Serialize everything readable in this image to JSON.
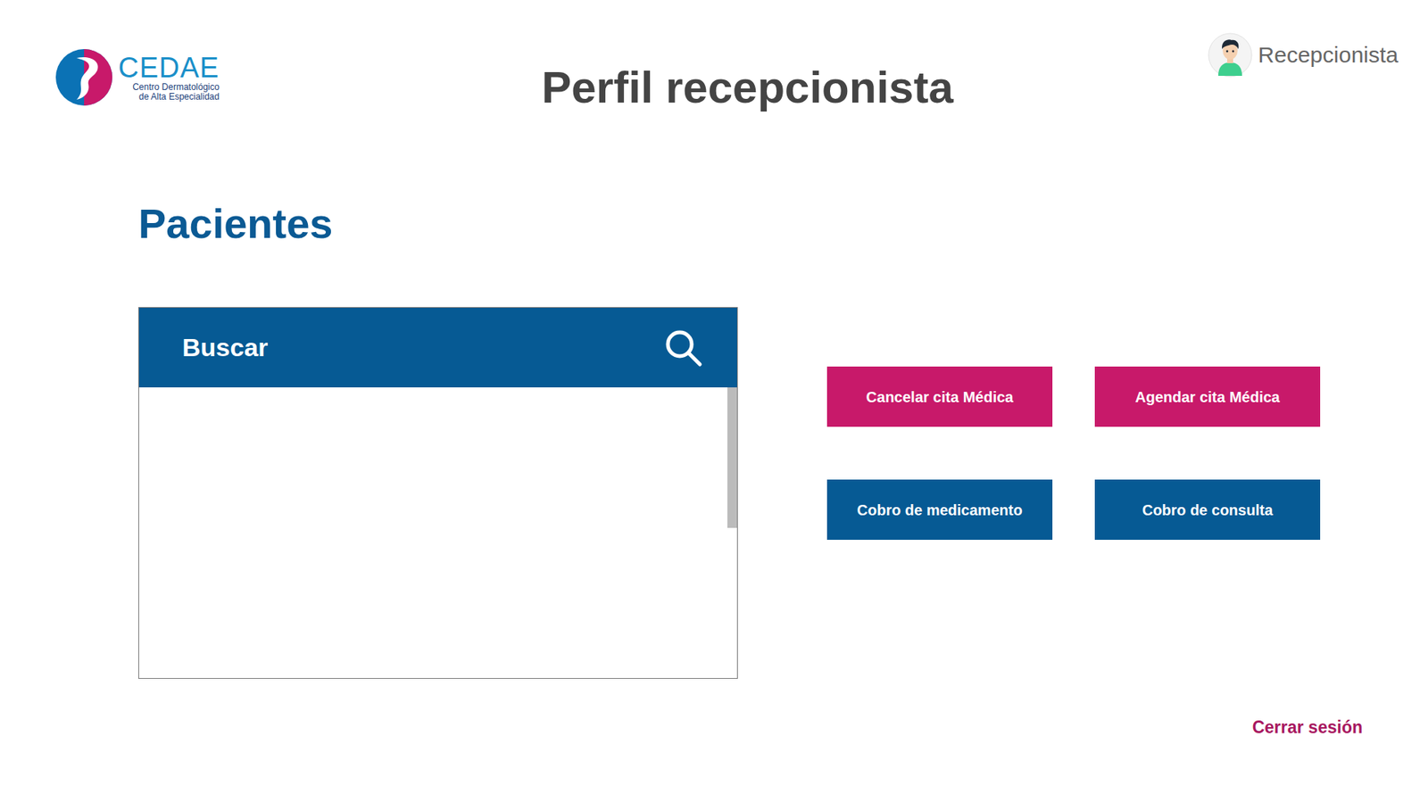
{
  "header": {
    "logo": {
      "name": "CEDAE",
      "subtitle_lines": [
        "Centro Dermatológico",
        "de Alta Especialidad"
      ]
    },
    "title": "Perfil recepcionista",
    "user": {
      "role": "Recepcionista"
    }
  },
  "section": {
    "title": "Pacientes"
  },
  "search": {
    "placeholder": "Buscar"
  },
  "actions": [
    {
      "label": "Cancelar cita Médica",
      "color": "#c8196a"
    },
    {
      "label": "Agendar cita Médica",
      "color": "#c8196a"
    },
    {
      "label": "Cobro de medicamento",
      "color": "#065a94"
    },
    {
      "label": "Cobro de consulta",
      "color": "#065a94"
    }
  ],
  "logout": "Cerrar sesión"
}
